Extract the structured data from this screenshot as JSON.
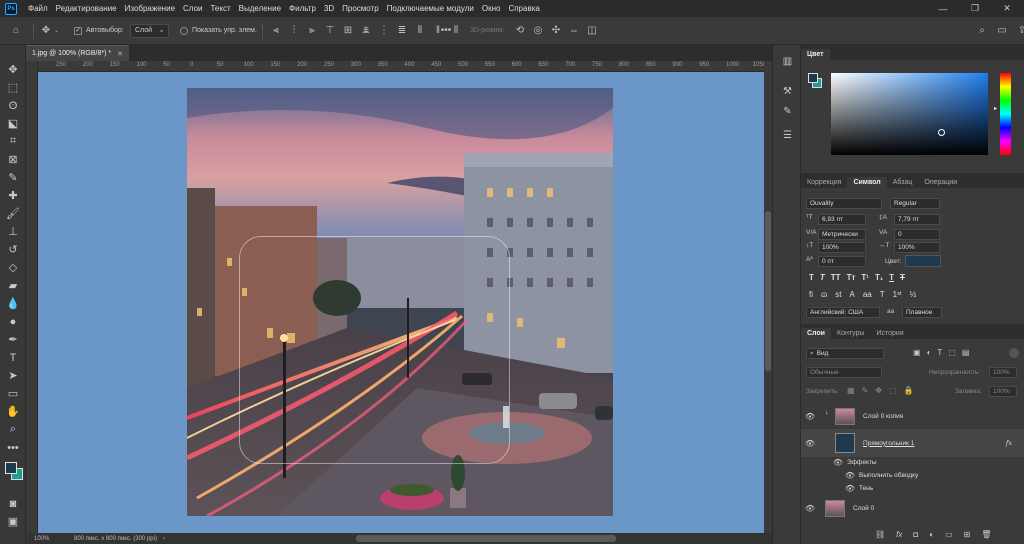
{
  "menu": [
    "Файл",
    "Редактирование",
    "Изображение",
    "Слои",
    "Текст",
    "Выделение",
    "Фильтр",
    "3D",
    "Просмотр",
    "Подключаемые модули",
    "Окно",
    "Справка"
  ],
  "app_logo": "Ps",
  "options": {
    "autoselect_label": "Автовыбор:",
    "autoselect_value": "Слой",
    "show_controls_label": "Показать упр. элем.",
    "mode3d_label": "3D-режим:"
  },
  "document": {
    "tab_title": "1.jpg @ 100% (RGB/8*) *",
    "zoom": "100%",
    "status_info": "800 пикс. x 800 пикс. (300 ppi)"
  },
  "ruler_ticks": [
    "250",
    "200",
    "150",
    "100",
    "50",
    "0",
    "50",
    "100",
    "150",
    "200",
    "250",
    "300",
    "350",
    "400",
    "450",
    "500",
    "550",
    "600",
    "650",
    "700",
    "750",
    "800",
    "850",
    "900",
    "950",
    "1000",
    "1050"
  ],
  "panels": {
    "color_tab": "Цвет",
    "char_tabs": [
      "Коррекция",
      "Символ",
      "Абзац",
      "Операции"
    ],
    "font_family": "Ouvality",
    "font_style": "Regular",
    "font_size": "6,93 пт",
    "leading": "7,79 пт",
    "kerning": "Метрически",
    "tracking": "0",
    "vscale": "100%",
    "hscale": "100%",
    "baseline": "0 пт",
    "color_label": "Цвет:",
    "text_color": "#1f3a4e",
    "language": "Английский: США",
    "antialias": "Плавное",
    "layer_tabs": [
      "Слои",
      "Контуры",
      "История"
    ],
    "filter_kind": "Вид",
    "blend_mode": "Обычные",
    "opacity_label": "Непрозрачность:",
    "opacity_value": "100%",
    "lock_label": "Закрепить:",
    "fill_label": "Заливка:",
    "fill_value": "100%",
    "layers": {
      "copy_name": "Слой 0 копия",
      "rect_name": "Прямоугольник 1",
      "effects": "Эффекты",
      "effect_stroke": "Выполнить обводку",
      "effect_shadow": "Тень",
      "base_name": "Слой 0",
      "fx": "fx"
    }
  },
  "colors": {
    "foreground": "#1f3a4e",
    "background": "#1e9e8e",
    "accent": "#31a8ff"
  }
}
